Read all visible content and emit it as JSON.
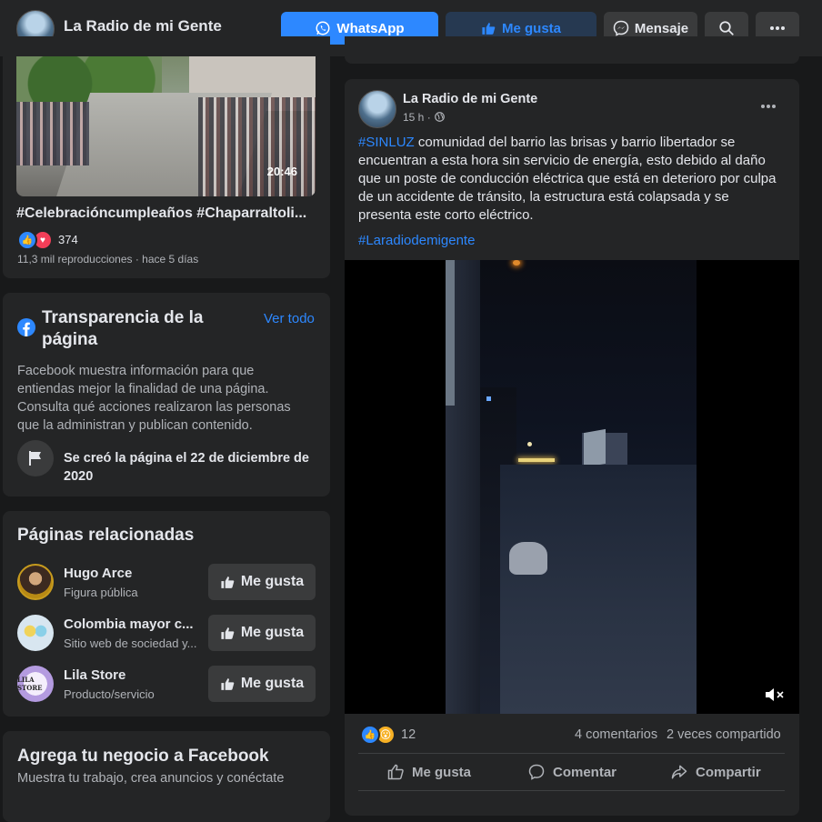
{
  "header": {
    "page_name": "La Radio de mi Gente",
    "whatsapp_label": "WhatsApp",
    "like_label": "Me gusta",
    "message_label": "Mensaje"
  },
  "video_card": {
    "duration": "20:46",
    "title": "#Celebracióncumpleaños #Chaparraltoli...",
    "reaction_count": "374",
    "meta": "11,3 mil reproducciones · hace 5 días"
  },
  "transparency": {
    "title": "Transparencia de la página",
    "see_all": "Ver todo",
    "description": "Facebook muestra información para que entiendas mejor la finalidad de una página. Consulta qué acciones realizaron las personas que la administran y publican contenido.",
    "created": "Se creó la página el 22 de diciembre de 2020"
  },
  "related": {
    "title": "Páginas relacionadas",
    "button_label": "Me gusta",
    "items": [
      {
        "name": "Hugo Arce",
        "category": "Figura pública"
      },
      {
        "name": "Colombia mayor c...",
        "category": "Sitio web de sociedad y..."
      },
      {
        "name": "Lila Store",
        "category": "Producto/servicio",
        "logo_text": "LILA STORE"
      }
    ]
  },
  "business": {
    "title": "Agrega tu negocio a Facebook",
    "description": "Muestra tu trabajo, crea anuncios y conéctate"
  },
  "post": {
    "author": "La Radio de mi Gente",
    "time": "15 h ·",
    "hashtag": "#SINLUZ",
    "text": " comunidad del barrio las brisas y barrio libertador se encuentran a esta hora sin servicio de energía, esto debido al daño que un poste de conducción eléctrica que está en deterioro por culpa de un accidente de tránsito, la estructura está colapsada y se presenta este corto eléctrico.",
    "hashtag2": "#Laradiodemigente",
    "reaction_count": "12",
    "comments": "4 comentarios",
    "shares": "2 veces compartido",
    "actions": {
      "like": "Me gusta",
      "comment": "Comentar",
      "share": "Compartir"
    }
  },
  "colors": {
    "accent": "#2d88ff",
    "background": "#18191a",
    "card": "#242526"
  },
  "icons": [
    "whatsapp-icon",
    "thumbs-up-icon",
    "messenger-icon",
    "search-icon",
    "more-icon",
    "globe-icon",
    "facebook-logo-icon",
    "flag-icon",
    "heart-icon",
    "wow-icon",
    "comment-icon",
    "share-icon",
    "mute-icon"
  ]
}
